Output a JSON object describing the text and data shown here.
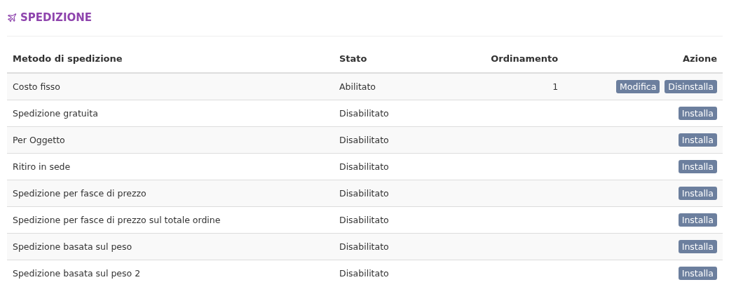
{
  "title": "SPEDIZIONE",
  "table": {
    "columns": [
      "Metodo di spedizione",
      "Stato",
      "Ordinamento",
      "Azione"
    ],
    "rows": [
      {
        "method": "Costo fisso",
        "status": "Abilitato",
        "order": "1",
        "actions": [
          "Modifica",
          "Disinstalla"
        ]
      },
      {
        "method": "Spedizione gratuita",
        "status": "Disabilitato",
        "actions": [
          "Installa"
        ]
      },
      {
        "method": "Per Oggetto",
        "status": "Disabilitato",
        "actions": [
          "Installa"
        ]
      },
      {
        "method": "Ritiro in sede",
        "status": "Disabilitato",
        "actions": [
          "Installa"
        ]
      },
      {
        "method": "Spedizione per fasce di prezzo",
        "status": "Disabilitato",
        "actions": [
          "Installa"
        ]
      },
      {
        "method": "Spedizione per fasce di prezzo sul totale ordine",
        "status": "Disabilitato",
        "actions": [
          "Installa"
        ]
      },
      {
        "method": "Spedizione basata sul peso",
        "status": "Disabilitato",
        "actions": [
          "Installa"
        ]
      },
      {
        "method": "Spedizione basata sul peso 2",
        "status": "Disabilitato",
        "actions": [
          "Installa"
        ]
      }
    ]
  }
}
